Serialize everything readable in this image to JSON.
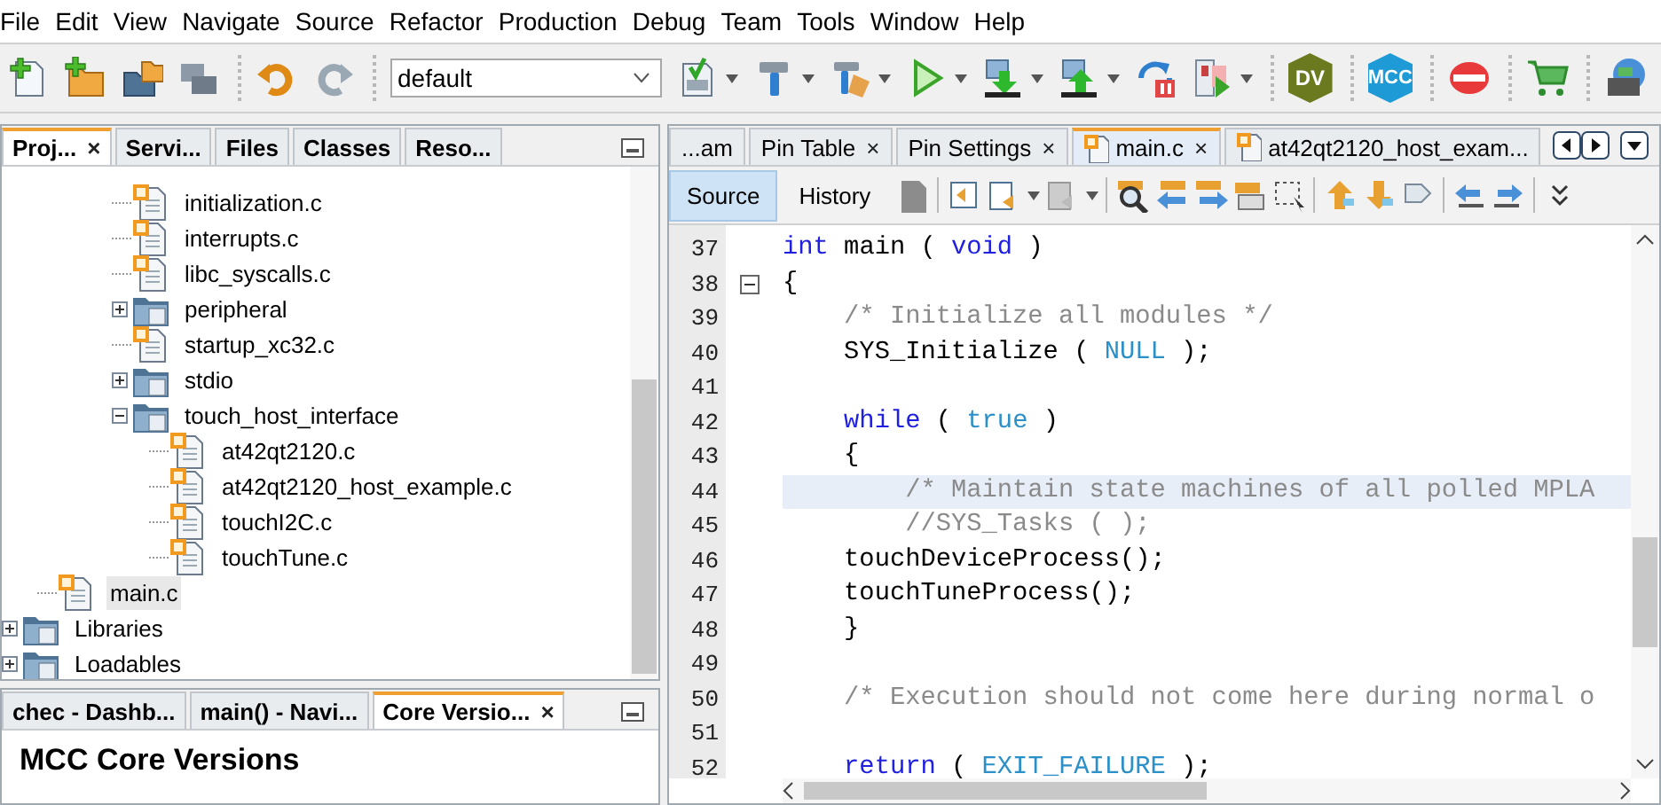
{
  "menu": [
    "File",
    "Edit",
    "View",
    "Navigate",
    "Source",
    "Refactor",
    "Production",
    "Debug",
    "Team",
    "Tools",
    "Window",
    "Help"
  ],
  "toolbar": {
    "configuration": "default",
    "badges": [
      {
        "text": "DV",
        "kind": "dv"
      },
      {
        "text": "MCC",
        "kind": "mcc"
      }
    ]
  },
  "projects_panel": {
    "tabs": [
      {
        "label": "Proj...",
        "selected": true,
        "close": "×"
      },
      {
        "label": "Servi...",
        "selected": false
      },
      {
        "label": "Files",
        "selected": false
      },
      {
        "label": "Classes",
        "selected": false
      },
      {
        "label": "Reso...",
        "selected": false
      }
    ],
    "tree": [
      {
        "children": [
          {
            "children": [
              {
                "children": [
                  {
                    "label": "initialization.c",
                    "kind": "file",
                    "selected": false
                  },
                  {
                    "label": "interrupts.c",
                    "kind": "file",
                    "selected": false
                  },
                  {
                    "label": "libc_syscalls.c",
                    "kind": "file",
                    "selected": false
                  },
                  {
                    "label": "peripheral",
                    "kind": "folder",
                    "expanded": false,
                    "selected": false
                  },
                  {
                    "label": "startup_xc32.c",
                    "kind": "file",
                    "selected": false
                  },
                  {
                    "label": "stdio",
                    "kind": "folder",
                    "expanded": false,
                    "selected": false
                  },
                  {
                    "label": "touch_host_interface",
                    "kind": "folder",
                    "expanded": true,
                    "selected": false,
                    "children": [
                      {
                        "label": "at42qt2120.c",
                        "kind": "file",
                        "selected": false
                      },
                      {
                        "label": "at42qt2120_host_example.c",
                        "kind": "file",
                        "selected": false
                      },
                      {
                        "label": "touchI2C.c",
                        "kind": "file",
                        "selected": false
                      },
                      {
                        "label": "touchTune.c",
                        "kind": "file",
                        "selected": false
                      }
                    ]
                  }
                ]
              }
            ]
          },
          {
            "label": "main.c",
            "kind": "file",
            "selected": true
          }
        ]
      },
      {
        "label": "Libraries",
        "kind": "folder",
        "expanded": false,
        "selected": false
      },
      {
        "label": "Loadables",
        "kind": "folder",
        "expanded": false,
        "selected": false
      }
    ]
  },
  "dashboard_panel": {
    "tabs": [
      {
        "label": "chec - Dashb...",
        "selected": false
      },
      {
        "label": "main() - Navi...",
        "selected": false
      },
      {
        "label": "Core Versio...",
        "selected": true,
        "close": "×"
      }
    ],
    "heading": "MCC Core Versions"
  },
  "editor": {
    "tabs": [
      {
        "label": "...am",
        "selected": false,
        "kind": "plain"
      },
      {
        "label": "Pin Table",
        "selected": false,
        "kind": "plain",
        "close": "×"
      },
      {
        "label": "Pin Settings",
        "selected": false,
        "kind": "plain",
        "close": "×"
      },
      {
        "label": "main.c",
        "selected": true,
        "kind": "file",
        "close": "×"
      },
      {
        "label": "at42qt2120_host_exam...",
        "selected": false,
        "kind": "file"
      }
    ],
    "views": [
      {
        "label": "Source",
        "selected": true
      },
      {
        "label": "History",
        "selected": false
      }
    ],
    "lines": [
      {
        "number": "37",
        "current": false,
        "tokens": [
          {
            "text": "int",
            "kind": "keyword"
          },
          {
            "text": " main ( ",
            "kind": "plain"
          },
          {
            "text": "void",
            "kind": "keyword"
          },
          {
            "text": " )",
            "kind": "plain"
          }
        ]
      },
      {
        "number": "38",
        "current": false,
        "fold": true,
        "tokens": [
          {
            "text": "{",
            "kind": "plain"
          }
        ]
      },
      {
        "number": "39",
        "current": false,
        "tokens": [
          {
            "text": "    /* Initialize all modules */",
            "kind": "comment"
          }
        ]
      },
      {
        "number": "40",
        "current": false,
        "tokens": [
          {
            "text": "    SYS_Initialize ( ",
            "kind": "plain"
          },
          {
            "text": "NULL",
            "kind": "constant"
          },
          {
            "text": " );",
            "kind": "plain"
          }
        ]
      },
      {
        "number": "41",
        "current": false
      },
      {
        "number": "42",
        "current": false,
        "tokens": [
          {
            "text": "    while",
            "kind": "keyword"
          },
          {
            "text": " ( ",
            "kind": "plain"
          },
          {
            "text": "true",
            "kind": "constant"
          },
          {
            "text": " )",
            "kind": "plain"
          }
        ]
      },
      {
        "number": "43",
        "current": false,
        "tokens": [
          {
            "text": "    {",
            "kind": "plain"
          }
        ]
      },
      {
        "number": "44",
        "current": true,
        "tokens": [
          {
            "text": "        /* Maintain state machines of all polled MPLA",
            "kind": "comment"
          }
        ]
      },
      {
        "number": "45",
        "current": false,
        "tokens": [
          {
            "text": "        //SYS_Tasks ( );",
            "kind": "comment"
          }
        ]
      },
      {
        "number": "46",
        "current": false,
        "tokens": [
          {
            "text": "    touchDeviceProcess();",
            "kind": "plain"
          }
        ]
      },
      {
        "number": "47",
        "current": false,
        "tokens": [
          {
            "text": "    touchTuneProcess();",
            "kind": "plain"
          }
        ]
      },
      {
        "number": "48",
        "current": false,
        "tokens": [
          {
            "text": "    }",
            "kind": "plain"
          }
        ]
      },
      {
        "number": "49",
        "current": false
      },
      {
        "number": "50",
        "current": false,
        "tokens": [
          {
            "text": "    /* Execution should not come here during normal o",
            "kind": "comment"
          }
        ]
      },
      {
        "number": "51",
        "current": false
      },
      {
        "number": "52",
        "current": false,
        "tokens": [
          {
            "text": "    return",
            "kind": "keyword"
          },
          {
            "text": " ( ",
            "kind": "plain"
          },
          {
            "text": "EXIT_FAILURE",
            "kind": "constant"
          },
          {
            "text": " );",
            "kind": "plain"
          }
        ]
      }
    ]
  }
}
